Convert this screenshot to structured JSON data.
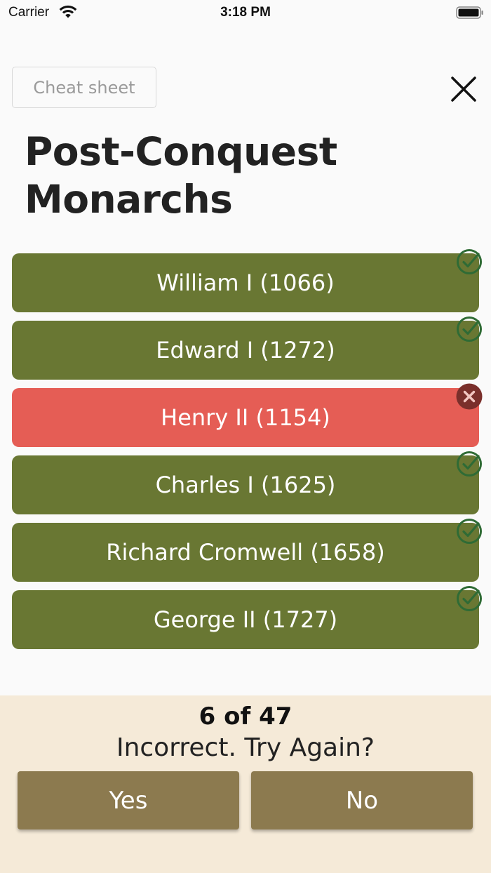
{
  "status_bar": {
    "carrier": "Carrier",
    "time": "3:18 PM"
  },
  "header": {
    "cheat_sheet_label": "Cheat sheet",
    "title_line1": "Post-Conquest",
    "title_line2": "Monarchs"
  },
  "answers": [
    {
      "label": "William I (1066)",
      "status": "correct"
    },
    {
      "label": "Edward I (1272)",
      "status": "correct"
    },
    {
      "label": "Henry II (1154)",
      "status": "incorrect"
    },
    {
      "label": "Charles I (1625)",
      "status": "correct"
    },
    {
      "label": "Richard Cromwell (1658)",
      "status": "correct"
    },
    {
      "label": "George II (1727)",
      "status": "correct"
    }
  ],
  "footer": {
    "progress": "6 of 47",
    "feedback": "Incorrect. Try Again?",
    "yes_label": "Yes",
    "no_label": "No"
  },
  "colors": {
    "correct_bg": "#697733",
    "incorrect_bg": "#e55d55",
    "check_badge": "#2f6b35",
    "cross_badge": "#7a2f2b",
    "footer_bg": "#f5ead8",
    "choice_button": "#8c7a4f"
  },
  "icons": {
    "close": "close-icon",
    "correct": "check-circle-icon",
    "incorrect": "cross-circle-icon"
  }
}
